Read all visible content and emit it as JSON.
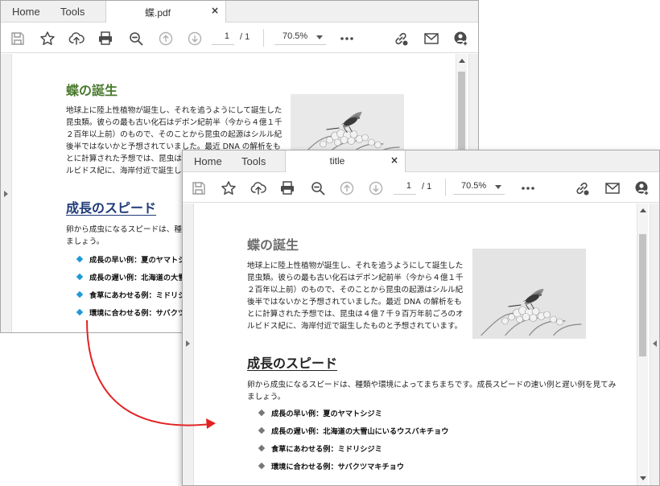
{
  "colors": {
    "accent_blue": "#1e9ad6",
    "title_green": "#4a7a2e",
    "heading_navy": "#1f3b78",
    "gray_title": "#6c6c6c",
    "gray_heading": "#222222",
    "gray_bullet": "#777777",
    "arrow_red": "#e32222"
  },
  "toolbar_icons": [
    "save-icon",
    "bookmark-star-icon",
    "upload-cloud-icon",
    "print-icon",
    "zoom-magnifier-icon",
    "page-up-icon",
    "page-down-icon",
    "more-dots-icon",
    "link-share-icon",
    "email-icon",
    "add-user-icon"
  ],
  "original": {
    "tabs": {
      "home": "Home",
      "tools": "Tools",
      "document": "蝶.pdf",
      "close": "×"
    },
    "toolbar": {
      "page_current": "1",
      "page_total": "/  1",
      "zoom": "70.5%"
    },
    "content": {
      "title": "蝶の誕生",
      "paragraph1": "地球上に陸上性植物が誕生し、それを追うようにして誕生した昆虫類。彼らの最も古い化石はデボン紀前半（今から４億１千２百年以上前）のもので、そのことから昆虫の起源はシルル紀後半ではないかと予想されていました。最近 DNA の解析をもとに計算された予想では、昆虫は４億７千９百万年前ごろのオルビドス紀に、海岸付近で誕生したものと予想されています。",
      "heading2": "成長のスピード",
      "paragraph2": "卵から成虫になるスピードは、種類や環境によってまちまちです。成長スピードの速い例と遅い例を見てみましょう。",
      "bullets": [
        "成長の早い例：夏のヤマトシジミ",
        "成長の遅い例：北海道の大雪山にいるウスバキチョウ",
        "食草にあわせる例：ミドリシジミ",
        "環境に合わせる例：サバクツマキチョウ"
      ]
    }
  },
  "converted": {
    "tabs": {
      "home": "Home",
      "tools": "Tools",
      "document": "title",
      "close": "×"
    },
    "toolbar": {
      "page_current": "1",
      "page_total": "/  1",
      "zoom": "70.5%"
    },
    "content": {
      "title": "蝶の誕生",
      "paragraph1": "地球上に陸上性植物が誕生し、それを追うようにして誕生した昆虫類。彼らの最も古い化石はデボン紀前半（今から４億１千２百年以上前）のもので、そのことから昆虫の起源はシルル紀後半ではないかと予想されていました。最近 DNA の解析をもとに計算された予想では、昆虫は４億７千９百万年前ごろのオルビドス紀に、海岸付近で誕生したものと予想されています。",
      "heading2": "成長のスピード",
      "paragraph2": "卵から成虫になるスピードは、種類や環境によってまちまちです。成長スピードの速い例と遅い例を見てみましょう。",
      "bullets": [
        "成長の早い例：夏のヤマトシジミ",
        "成長の遅い例：北海道の大雪山にいるウスバキチョウ",
        "食草にあわせる例：ミドリシジミ",
        "環境に合わせる例：サバクツマキチョウ"
      ]
    }
  }
}
